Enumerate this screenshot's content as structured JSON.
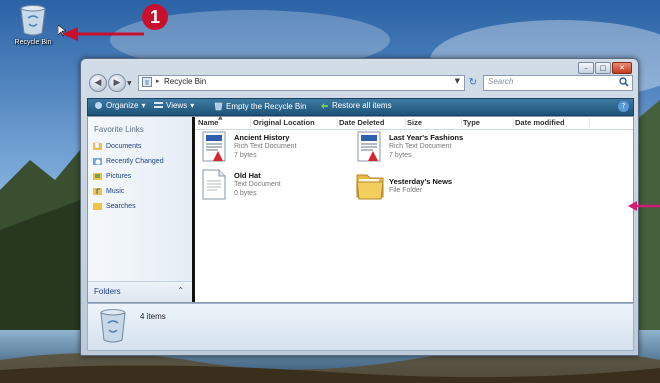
{
  "desktop": {
    "recycle_bin_label": "Recycle Bin",
    "callout_number": "1",
    "callout_color": "#c8102e"
  },
  "window": {
    "address": {
      "path": "Recycle Bin",
      "breadcrumb_icon": "recycle-bin-icon"
    },
    "search": {
      "placeholder": "Search"
    },
    "toolbar": {
      "organize": "Organize",
      "views": "Views",
      "empty": "Empty the Recycle Bin",
      "restore": "Restore all items",
      "help": "?"
    },
    "sidebar": {
      "heading": "Favorite Links",
      "items": [
        {
          "label": "Documents",
          "icon": "documents-icon"
        },
        {
          "label": "Recently Changed",
          "icon": "recently-changed-icon"
        },
        {
          "label": "Pictures",
          "icon": "pictures-icon"
        },
        {
          "label": "Music",
          "icon": "music-icon"
        },
        {
          "label": "Searches",
          "icon": "searches-icon"
        }
      ],
      "folders_label": "Folders"
    },
    "columns": [
      "Name",
      "Original Location",
      "Date Deleted",
      "Size",
      "Type",
      "Date modified"
    ],
    "files": [
      {
        "name": "Ancient History",
        "type": "Rich Text Document",
        "size": "7 bytes",
        "icon": "rtf-document-icon"
      },
      {
        "name": "Last Year's Fashions",
        "type": "Rich Text Document",
        "size": "7 bytes",
        "icon": "rtf-document-icon"
      },
      {
        "name": "Old Hat",
        "type": "Text Document",
        "size": "0 bytes",
        "icon": "text-document-icon"
      },
      {
        "name": "Yesterday's News",
        "type": "File Folder",
        "size": "",
        "icon": "folder-icon"
      }
    ],
    "details": {
      "count": "4 items"
    }
  }
}
